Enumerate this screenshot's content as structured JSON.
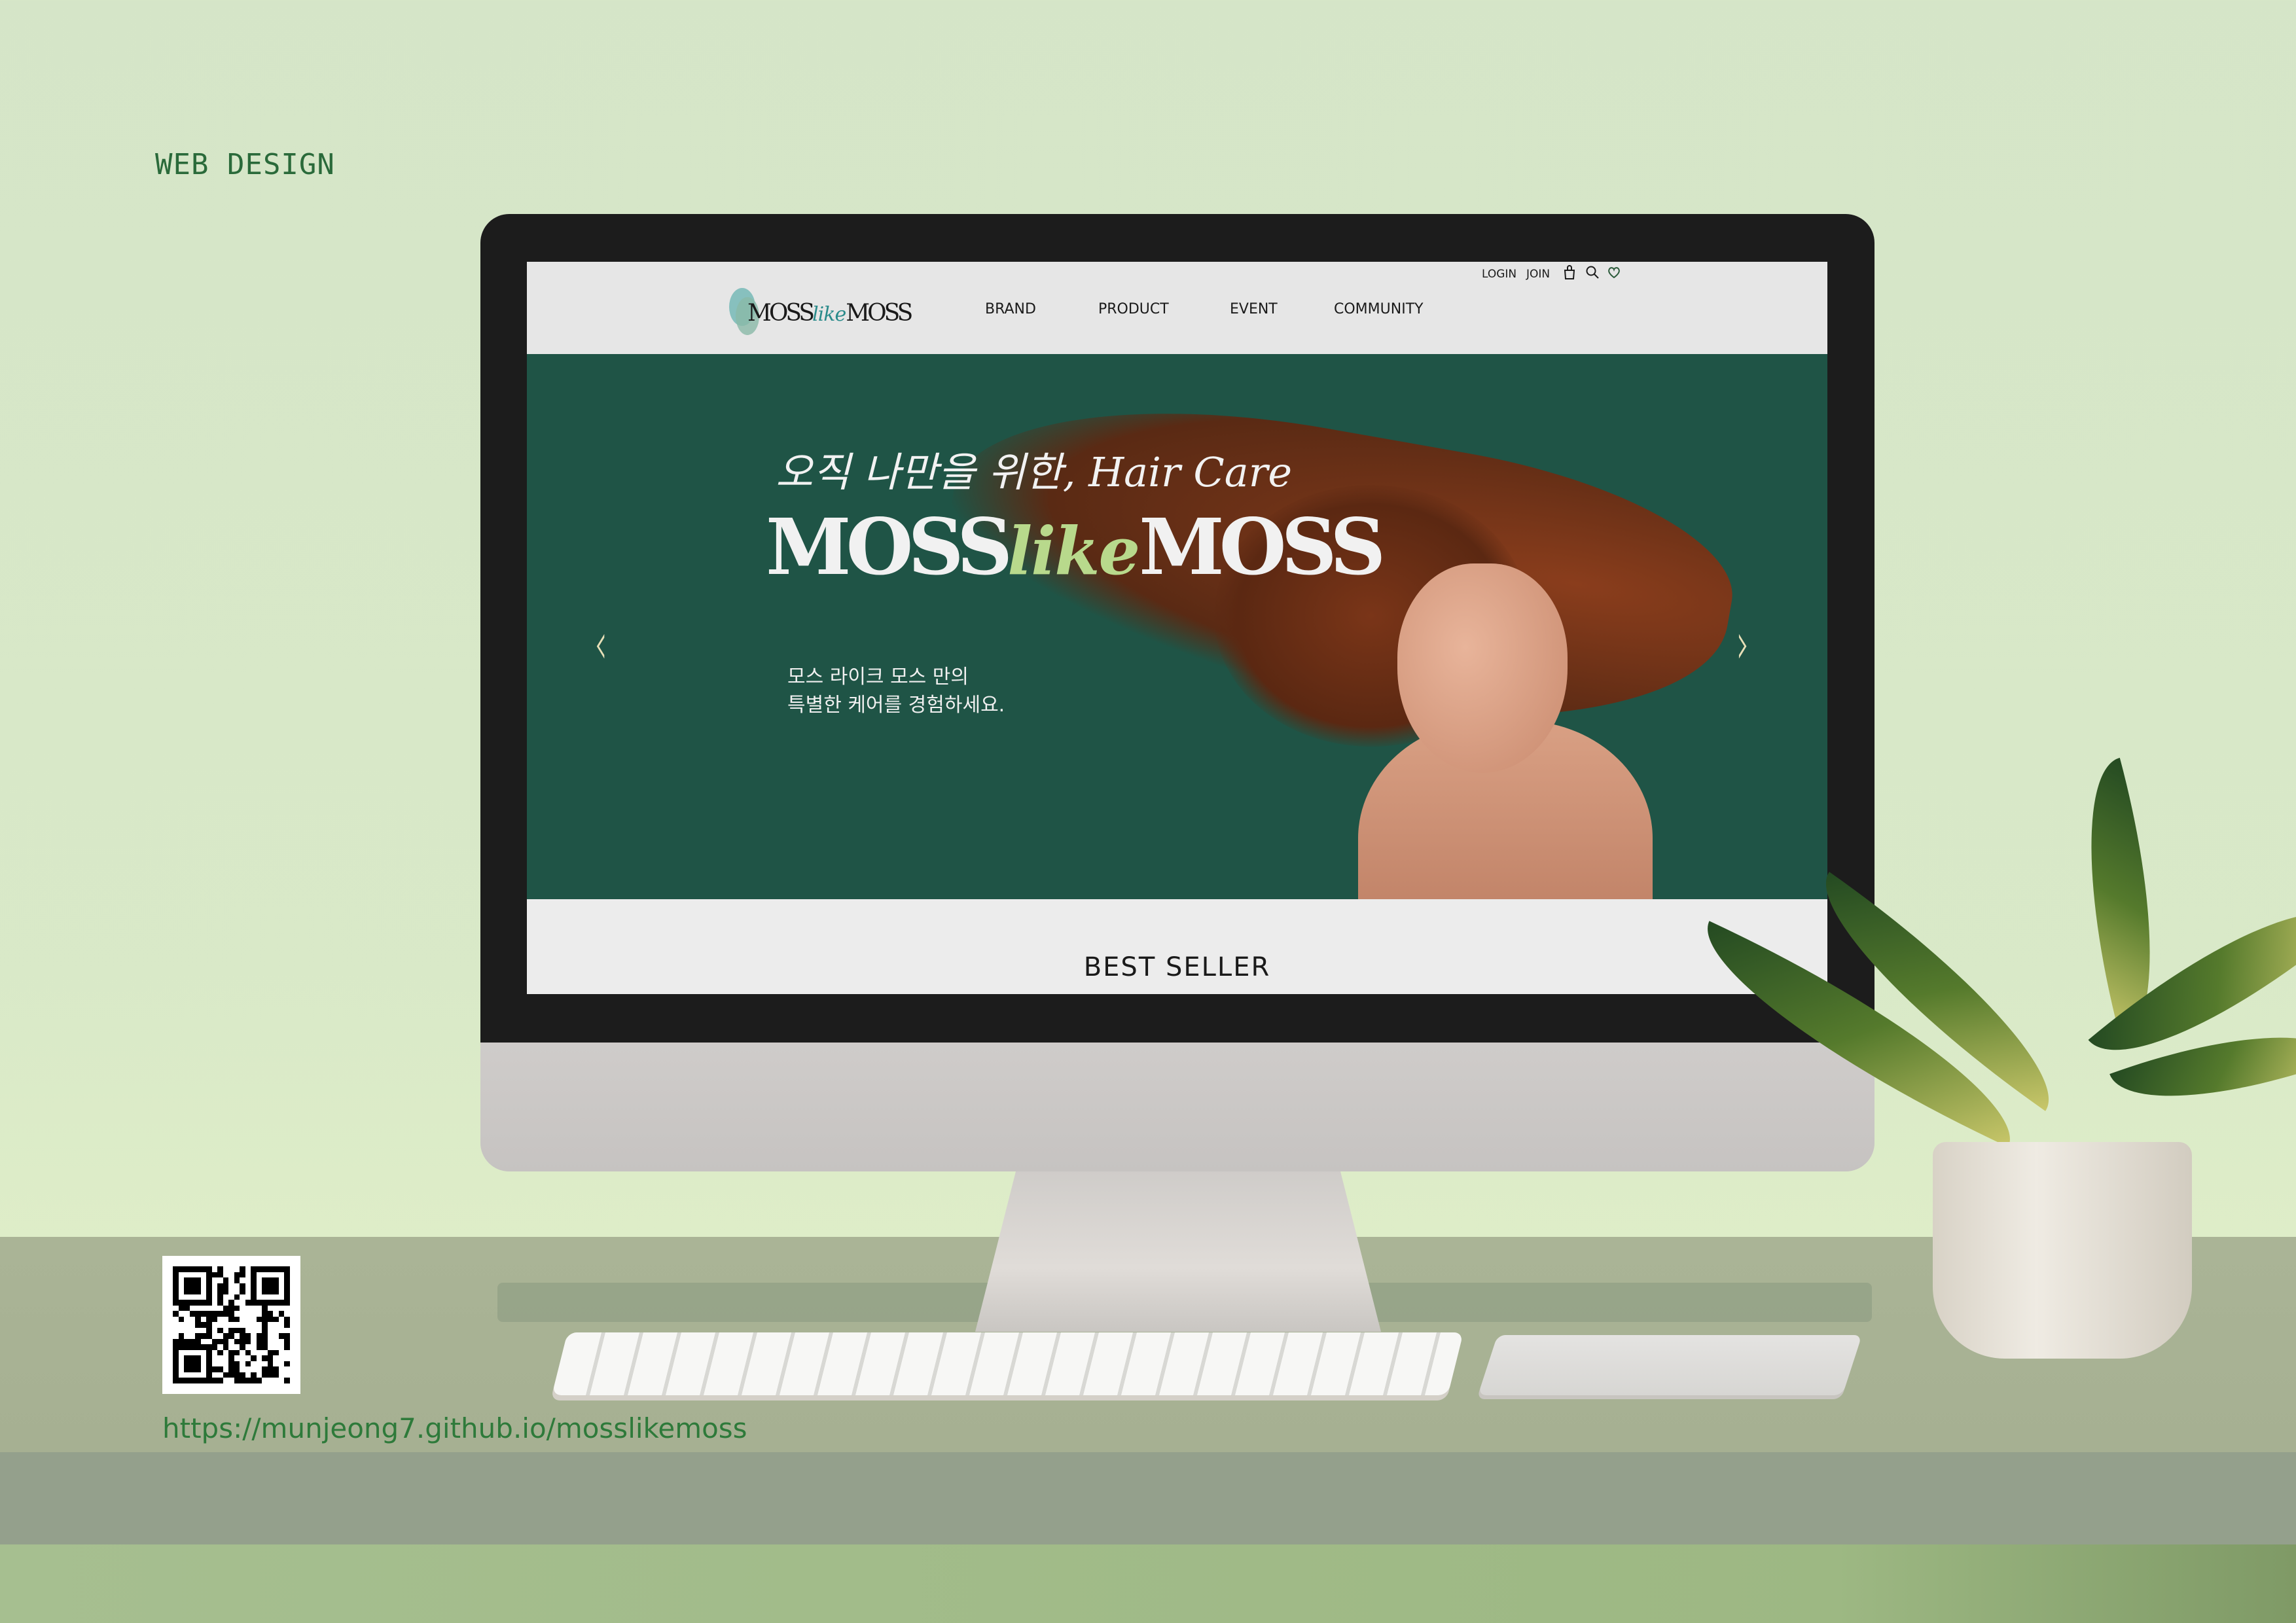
{
  "page": {
    "label": "WEB DESIGN",
    "url": "https://munjeong7.github.io/mosslikemoss"
  },
  "site": {
    "logo": {
      "part1": "MOSS",
      "part2": "like",
      "part3": "MOSS"
    },
    "nav": [
      {
        "label": "BRAND"
      },
      {
        "label": "PRODUCT"
      },
      {
        "label": "EVENT"
      },
      {
        "label": "COMMUNITY"
      }
    ],
    "utility": {
      "login": "LOGIN",
      "join": "JOIN"
    },
    "hero": {
      "tagline": "오직 나만을 위한, Hair Care",
      "title1": "MOSS",
      "title2": "like",
      "title3": "MOSS",
      "desc_line1": "모스 라이크 모스 만의",
      "desc_line2": "특별한 케어를 경험하세요.",
      "prev": "‹",
      "next": "›"
    },
    "section_title": "BEST SELLER"
  },
  "colors": {
    "hero_bg": "#1f5446",
    "accent": "#b8d98c",
    "url": "#2e7a3a"
  }
}
